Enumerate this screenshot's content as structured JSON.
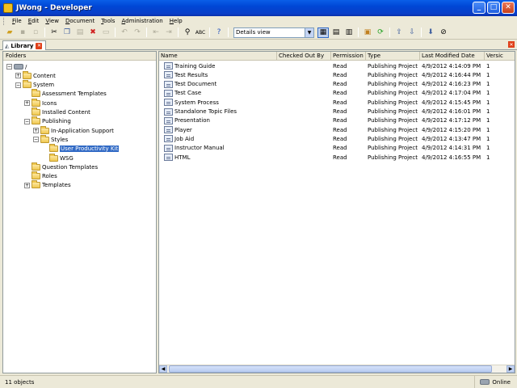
{
  "window": {
    "title": "JWong - Developer"
  },
  "menu": [
    {
      "ul": "F",
      "rest": "ile"
    },
    {
      "ul": "E",
      "rest": "dit"
    },
    {
      "ul": "V",
      "rest": "iew"
    },
    {
      "ul": "D",
      "rest": "ocument"
    },
    {
      "ul": "T",
      "rest": "ools"
    },
    {
      "ul": "A",
      "rest": "dministration"
    },
    {
      "ul": "H",
      "rest": "elp"
    }
  ],
  "toolbar": {
    "view_select": "Details view"
  },
  "tabs": {
    "library": "Library"
  },
  "folders": {
    "header": "Folders",
    "items": [
      {
        "label": "/",
        "level": 0,
        "exp": "⊟",
        "icon": "lib"
      },
      {
        "label": "Content",
        "level": 1,
        "exp": "+",
        "icon": "folder"
      },
      {
        "label": "System",
        "level": 1,
        "exp": "−",
        "icon": "folder"
      },
      {
        "label": "Assessment Templates",
        "level": 2,
        "exp": "",
        "icon": "folder"
      },
      {
        "label": "Icons",
        "level": 2,
        "exp": "+",
        "icon": "folder"
      },
      {
        "label": "Installed Content",
        "level": 2,
        "exp": "",
        "icon": "folder"
      },
      {
        "label": "Publishing",
        "level": 2,
        "exp": "−",
        "icon": "folder"
      },
      {
        "label": "In-Application Support",
        "level": 3,
        "exp": "+",
        "icon": "folder"
      },
      {
        "label": "Styles",
        "level": 3,
        "exp": "−",
        "icon": "folder"
      },
      {
        "label": "User Productivity Kit",
        "level": 4,
        "exp": "",
        "icon": "folder",
        "selected": true
      },
      {
        "label": "WSG",
        "level": 4,
        "exp": "",
        "icon": "folder"
      },
      {
        "label": "Question Templates",
        "level": 2,
        "exp": "",
        "icon": "folder"
      },
      {
        "label": "Roles",
        "level": 2,
        "exp": "",
        "icon": "folder"
      },
      {
        "label": "Templates",
        "level": 2,
        "exp": "+",
        "icon": "folder"
      }
    ]
  },
  "details": {
    "columns": [
      "Name",
      "Checked Out By",
      "Permission",
      "Type",
      "Last Modified Date",
      "Versic"
    ],
    "rows": [
      [
        "Training Guide",
        "",
        "Read",
        "Publishing Project",
        "4/9/2012 4:14:09 PM",
        "1"
      ],
      [
        "Test Results",
        "",
        "Read",
        "Publishing Project",
        "4/9/2012 4:16:44 PM",
        "1"
      ],
      [
        "Test Document",
        "",
        "Read",
        "Publishing Project",
        "4/9/2012 4:16:23 PM",
        "1"
      ],
      [
        "Test Case",
        "",
        "Read",
        "Publishing Project",
        "4/9/2012 4:17:04 PM",
        "1"
      ],
      [
        "System Process",
        "",
        "Read",
        "Publishing Project",
        "4/9/2012 4:15:45 PM",
        "1"
      ],
      [
        "Standalone Topic Files",
        "",
        "Read",
        "Publishing Project",
        "4/9/2012 4:16:01 PM",
        "1"
      ],
      [
        "Presentation",
        "",
        "Read",
        "Publishing Project",
        "4/9/2012 4:17:12 PM",
        "1"
      ],
      [
        "Player",
        "",
        "Read",
        "Publishing Project",
        "4/9/2012 4:15:20 PM",
        "1"
      ],
      [
        "Job Aid",
        "",
        "Read",
        "Publishing Project",
        "4/9/2012 4:13:47 PM",
        "1"
      ],
      [
        "Instructor Manual",
        "",
        "Read",
        "Publishing Project",
        "4/9/2012 4:14:31 PM",
        "1"
      ],
      [
        "HTML",
        "",
        "Read",
        "Publishing Project",
        "4/9/2012 4:16:55 PM",
        "1"
      ]
    ]
  },
  "status": {
    "left": "11 objects",
    "right": "Online"
  }
}
